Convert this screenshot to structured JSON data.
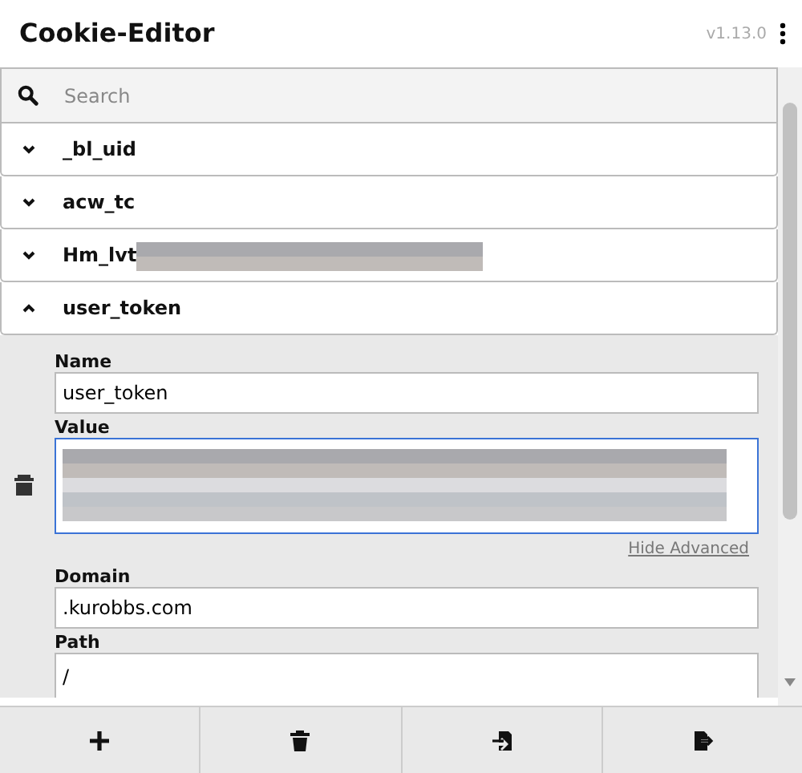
{
  "header": {
    "title": "Cookie-Editor",
    "version": "v1.13.0"
  },
  "search": {
    "placeholder": "Search"
  },
  "cookies": [
    {
      "name": "_bl_uid",
      "expanded": false
    },
    {
      "name": "acw_tc",
      "expanded": false
    },
    {
      "name": "Hm_lvt",
      "expanded": false,
      "blurred": true
    },
    {
      "name": "user_token",
      "expanded": true,
      "fields": [
        {
          "label": "Name",
          "kind": "input",
          "value": "user_token",
          "focused": false
        },
        {
          "label": "Value",
          "kind": "textarea",
          "focused": true,
          "blurred": true
        },
        {
          "label": "Domain",
          "kind": "input",
          "value": ".kurobbs.com",
          "focused": false
        },
        {
          "label": "Path",
          "kind": "input",
          "value": "/",
          "focused": false
        }
      ],
      "advanced_link": "Hide Advanced"
    }
  ],
  "footer_buttons": [
    {
      "kind": "add"
    },
    {
      "kind": "delete"
    },
    {
      "kind": "import"
    },
    {
      "kind": "export"
    }
  ]
}
